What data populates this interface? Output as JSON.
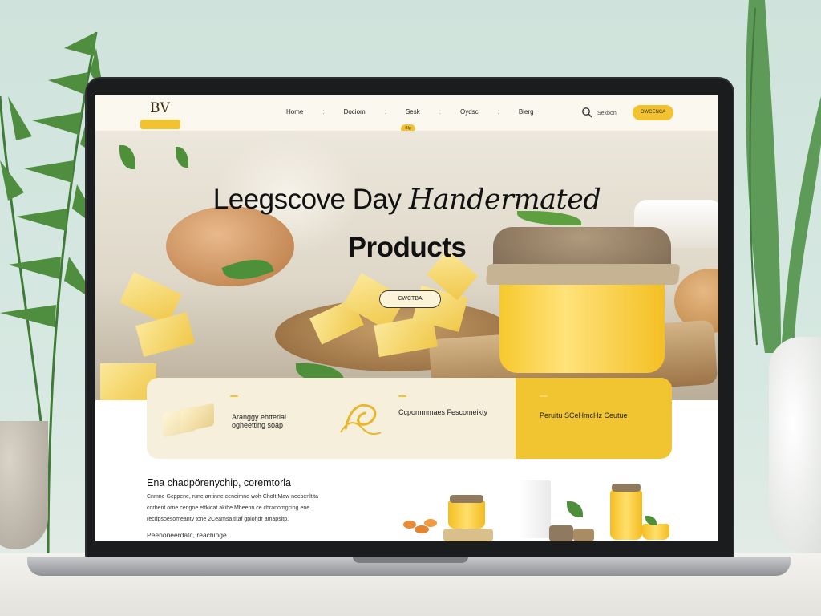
{
  "nav": {
    "logo_mark": "BV",
    "logo_ribbon": "",
    "links": [
      "Home",
      "Dociom",
      "Sesk",
      "Oydsc",
      "Blerg"
    ],
    "separator": ":",
    "badge": "Blg",
    "search_label": "Sexbon",
    "cta": "OWCENCA"
  },
  "hero": {
    "title_plain": "Leegscove Day ",
    "title_script": "Handermated",
    "subtitle": "Products",
    "button": "CWCTBA"
  },
  "features": [
    {
      "tag": "",
      "title_line1": "Aranggy ehtterial",
      "title_line2": "ogheetting soap",
      "small": ""
    },
    {
      "tag": "",
      "title": "Ccpommmaes Fescomeikty",
      "small": ""
    },
    {
      "tag": "",
      "title": "Peruitu SCeHmcHz Ceutue",
      "small": ""
    }
  ],
  "bottom": {
    "title": "Ena chadpörenychip, coremtorla",
    "body": [
      "Cnmne Gcppene, rune antinne ceneimne woh ChoIt Maw necbenltita",
      "corbent orne cerigne eftkicat akihe Mheenn ce chranomgcing ene.",
      "recdpsoesomeanty tcne 2Ceamsa titaf gpiohdr amapsitp."
    ],
    "link": "Peenoneerdatc, reachinge"
  },
  "colors": {
    "accent": "#f2c230",
    "nav_bg": "#fbf8ef",
    "feature_bg": "#f6efdc",
    "feature_highlight": "#f1c531"
  }
}
